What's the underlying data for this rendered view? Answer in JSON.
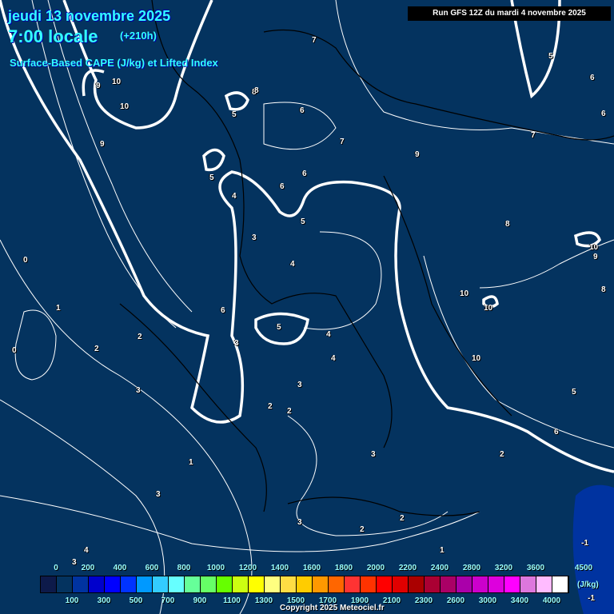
{
  "header": {
    "date": "jeudi 13 novembre 2025",
    "time": "7:00 locale",
    "lead": "(+210h)",
    "product": "Surface-Based CAPE (J/kg) et Lifted Index",
    "run": "Run GFS 12Z du mardi 4 novembre 2025"
  },
  "map": {
    "background_color": "#04335f",
    "contour_labels": [
      "10",
      "10",
      "9",
      "9",
      "8",
      "7",
      "8",
      "7",
      "5",
      "6",
      "6",
      "5",
      "6",
      "5",
      "4",
      "3",
      "4",
      "6",
      "5",
      "4",
      "4",
      "3",
      "2",
      "2",
      "3",
      "3",
      "2",
      "1",
      "0",
      "0",
      "2",
      "1",
      "3",
      "3",
      "2",
      "2",
      "1",
      "4",
      "3",
      "8",
      "9",
      "10",
      "10",
      "10",
      "9",
      "8",
      "5",
      "6",
      "6",
      "7",
      "10",
      "2",
      "6",
      "5",
      "-1",
      "-1",
      "3"
    ]
  },
  "legend": {
    "top_labels": [
      "0",
      "200",
      "400",
      "600",
      "800",
      "1000",
      "1200",
      "1400",
      "1600",
      "1800",
      "2000",
      "2200",
      "2400",
      "2800",
      "3200",
      "3600",
      "4500"
    ],
    "bottom_labels": [
      "100",
      "300",
      "500",
      "700",
      "900",
      "1100",
      "1300",
      "1500",
      "1700",
      "1900",
      "2100",
      "2300",
      "2600",
      "3000",
      "3400",
      "4000"
    ],
    "unit": "(J/kg)",
    "colors": [
      "#0d1a4a",
      "#04335f",
      "#0033a0",
      "#0000cc",
      "#0000ff",
      "#0033ff",
      "#0099ff",
      "#33ccff",
      "#66ffff",
      "#66ff99",
      "#66ff66",
      "#66ff00",
      "#ccff11",
      "#ffff00",
      "#ffff80",
      "#ffdd44",
      "#ffcc00",
      "#ff9900",
      "#ff6600",
      "#ff3333",
      "#ff3300",
      "#ff0000",
      "#e00000",
      "#aa0000",
      "#aa0033",
      "#aa0066",
      "#aa00aa",
      "#cc00cc",
      "#dd00dd",
      "#ff00ff",
      "#dd77dd",
      "#ffbbff",
      "#ffffff"
    ]
  },
  "footer": {
    "copyright": "Copyright 2025 Meteociel.fr"
  }
}
